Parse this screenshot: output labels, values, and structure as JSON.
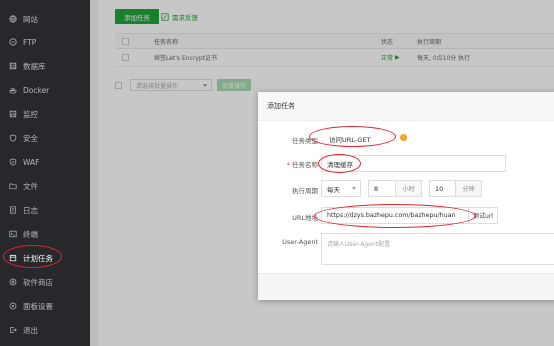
{
  "sidebar": {
    "items": [
      {
        "label": "网站",
        "icon": "globe-icon"
      },
      {
        "label": "FTP",
        "icon": "ftp-icon"
      },
      {
        "label": "数据库",
        "icon": "database-icon"
      },
      {
        "label": "Docker",
        "icon": "docker-icon"
      },
      {
        "label": "监控",
        "icon": "monitor-icon"
      },
      {
        "label": "安全",
        "icon": "shield-icon"
      },
      {
        "label": "WAF",
        "icon": "waf-icon"
      },
      {
        "label": "文件",
        "icon": "folder-icon"
      },
      {
        "label": "日志",
        "icon": "log-icon"
      },
      {
        "label": "终端",
        "icon": "terminal-icon"
      },
      {
        "label": "计划任务",
        "icon": "calendar-icon"
      },
      {
        "label": "软件商店",
        "icon": "store-icon"
      },
      {
        "label": "面板设置",
        "icon": "settings-icon"
      },
      {
        "label": "退出",
        "icon": "logout-icon"
      }
    ],
    "active_index": 10
  },
  "toolbar": {
    "add_task_label": "添加任务",
    "feedback_label": "需求反馈"
  },
  "table": {
    "columns": [
      "任务名称",
      "状态",
      "执行周期",
      "保"
    ],
    "rows": [
      {
        "name": "续签Let's Encrypt证书",
        "status": "正常",
        "cycle": "每天, 0点10分 执行",
        "extra": "--"
      }
    ]
  },
  "bulk": {
    "placeholder": "请选择批量操作",
    "button_label": "批量操作"
  },
  "modal": {
    "title": "添加任务",
    "fields": {
      "task_type_label": "任务类型",
      "task_type_value": "访问URL-GET",
      "task_name_label": "任务名称",
      "task_name_value": "清理缓存",
      "cycle_label": "执行周期",
      "cycle_value": "每天",
      "hour_value": "8",
      "hour_unit": "小时",
      "minute_value": "10",
      "minute_unit": "分钟",
      "url_label": "URL地址",
      "url_value": "https://dzys.bazhepu.com/bazhepu/huan",
      "test_url_label": "测试url",
      "ua_label": "User-Agent",
      "ua_placeholder": "请输入User-Agent配置"
    }
  },
  "colors": {
    "sidebar_bg": "#26282c",
    "accent_green": "#20a53a",
    "annotation_red": "#e3232e",
    "warning_orange": "#f0a020"
  }
}
